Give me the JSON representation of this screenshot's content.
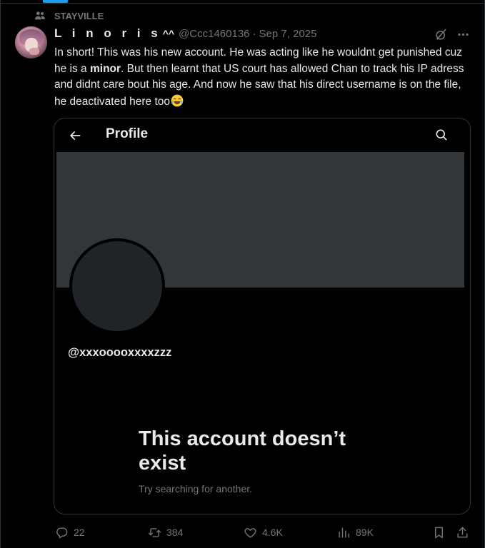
{
  "community": {
    "name": "STAYVILLE",
    "icon": "people-icon"
  },
  "post": {
    "author": {
      "display_name": "L i n o r i s",
      "display_suffix": "^^",
      "handle": "@Ccc1460136",
      "avatar": "user-avatar"
    },
    "separator": "·",
    "date": "Sep 7, 2025",
    "text_parts": {
      "p1": "In short! This was his new account. He was acting like he wouldnt get punished cuz he is a ",
      "bold": "minor",
      "p2": ". But then learnt that US court has allowed Chan to track his IP adress and didnt care bout his age. And now he saw that his direct username is on the file, he deactivated here too",
      "emoji": "face-with-tears-of-joy"
    },
    "media": {
      "screen_title": "Profile",
      "profile_handle": "@xxxooooxxxxzzz",
      "heading": "This account doesn’t exist",
      "subtext": "Try searching for another."
    },
    "stats": {
      "replies": "22",
      "reposts": "384",
      "likes": "4.6K",
      "views": "89K"
    }
  },
  "colors": {
    "background": "#000000",
    "text_primary": "#e7e9ea",
    "text_secondary": "#71767b",
    "border": "#2f3336",
    "accent": "#1d9bf0",
    "banner": "#333639",
    "avatar_placeholder": "#202327"
  }
}
